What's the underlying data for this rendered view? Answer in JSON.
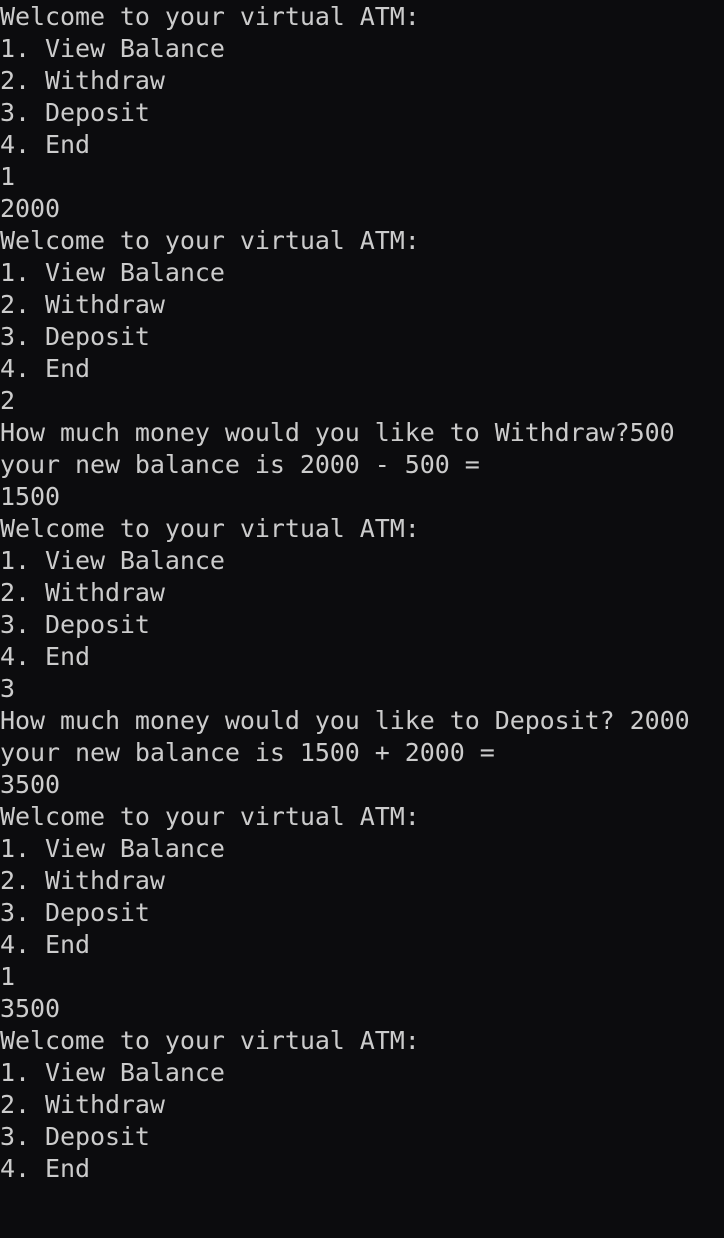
{
  "terminal": {
    "lines": [
      "Welcome to your virtual ATM:",
      "1. View Balance",
      "2. Withdraw",
      "3. Deposit",
      "4. End",
      "1",
      "2000",
      "Welcome to your virtual ATM:",
      "1. View Balance",
      "2. Withdraw",
      "3. Deposit",
      "4. End",
      "2",
      "How much money would you like to Withdraw?500",
      "your new balance is 2000 - 500 =",
      "1500",
      "Welcome to your virtual ATM:",
      "1. View Balance",
      "2. Withdraw",
      "3. Deposit",
      "4. End",
      "3",
      "How much money would you like to Deposit? 2000",
      "your new balance is 1500 + 2000 =",
      "3500",
      "Welcome to your virtual ATM:",
      "1. View Balance",
      "2. Withdraw",
      "3. Deposit",
      "4. End",
      "1",
      "3500",
      "Welcome to your virtual ATM:",
      "1. View Balance",
      "2. Withdraw",
      "3. Deposit",
      "4. End"
    ]
  },
  "colors": {
    "background": "#0c0c0e",
    "foreground": "#cccccc"
  }
}
